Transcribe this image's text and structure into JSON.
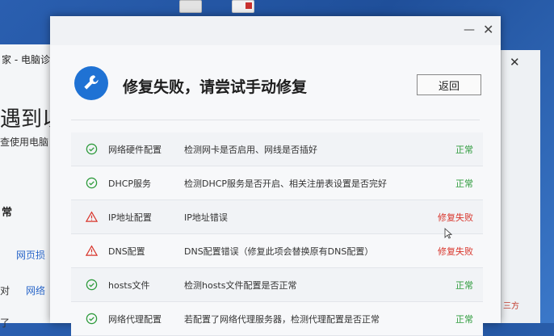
{
  "background": {
    "left_window": {
      "title_fragment": "家 - 电脑诊",
      "heading_fragment": "遇到以",
      "subtitle_fragment": "查使用电脑",
      "section_fragment": "常",
      "link1_fragment": "网页损",
      "row_prefix": "对",
      "link2_fragment": "网络",
      "row3_prefix": "了"
    },
    "right_window": {
      "text_fragment": "三方"
    }
  },
  "dialog": {
    "header": {
      "title": "修复失败，请尝试手动修复",
      "back_label": "返回",
      "header_icon": "wrench-icon"
    },
    "items": [
      {
        "name": "网络硬件配置",
        "desc": "检测网卡是否启用、网线是否插好",
        "status": "正常",
        "state": "ok"
      },
      {
        "name": "DHCP服务",
        "desc": "检测DHCP服务是否开启、相关注册表设置是否完好",
        "status": "正常",
        "state": "ok"
      },
      {
        "name": "IP地址配置",
        "desc": "IP地址错误",
        "status": "修复失败",
        "state": "fail"
      },
      {
        "name": "DNS配置",
        "desc": "DNS配置错误（修复此项会替换原有DNS配置）",
        "status": "修复失败",
        "state": "fail"
      },
      {
        "name": "hosts文件",
        "desc": "检测hosts文件配置是否正常",
        "status": "正常",
        "state": "ok"
      },
      {
        "name": "网络代理配置",
        "desc": "若配置了网络代理服务器，检测代理配置是否正常",
        "status": "正常",
        "state": "ok"
      }
    ]
  },
  "colors": {
    "ok": "#2e9b3c",
    "fail": "#d8342a",
    "accent": "#1f72d4"
  }
}
